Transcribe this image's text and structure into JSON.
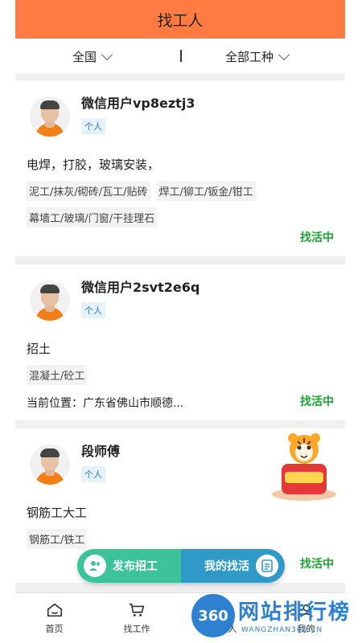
{
  "header": {
    "title": "找工人"
  },
  "filters": {
    "region": "全国",
    "trade": "全部工种"
  },
  "cards": [
    {
      "name": "微信用户vp8eztj3",
      "badge": "个人",
      "skills": "电焊，打胶，玻璃安装，",
      "tags": [
        "泥工/抹灰/砌砖/瓦工/贴砖",
        "焊工/铆工/钣金/钳工",
        "幕墙工/玻璃/门窗/干挂理石"
      ],
      "location": "",
      "status": "找活中"
    },
    {
      "name": "微信用户2svt2e6q",
      "badge": "个人",
      "skills": "招土",
      "tags": [
        "混凝土/砼工"
      ],
      "location": "当前位置：广东省佛山市顺德...",
      "status": "找活中"
    },
    {
      "name": "段师傅",
      "badge": "个人",
      "skills": "钢筋工大工",
      "tags": [
        "钢筋工/铁工"
      ],
      "location": "",
      "status": "找活中"
    }
  ],
  "fab": {
    "publish_label": "发布招工",
    "my_jobs_label": "我的找活"
  },
  "nav": {
    "home": "首页",
    "find_work": "找工作",
    "find_workers": "找工人",
    "mine": "我的"
  },
  "watermark": {
    "badge": "360",
    "title": "网站排行榜",
    "subtitle": "WANGZHAN360.CN"
  },
  "colors": {
    "header": "#ff7b42",
    "status": "#19a533",
    "publish": "#3cc39a",
    "my_jobs": "#2f9ac8"
  }
}
